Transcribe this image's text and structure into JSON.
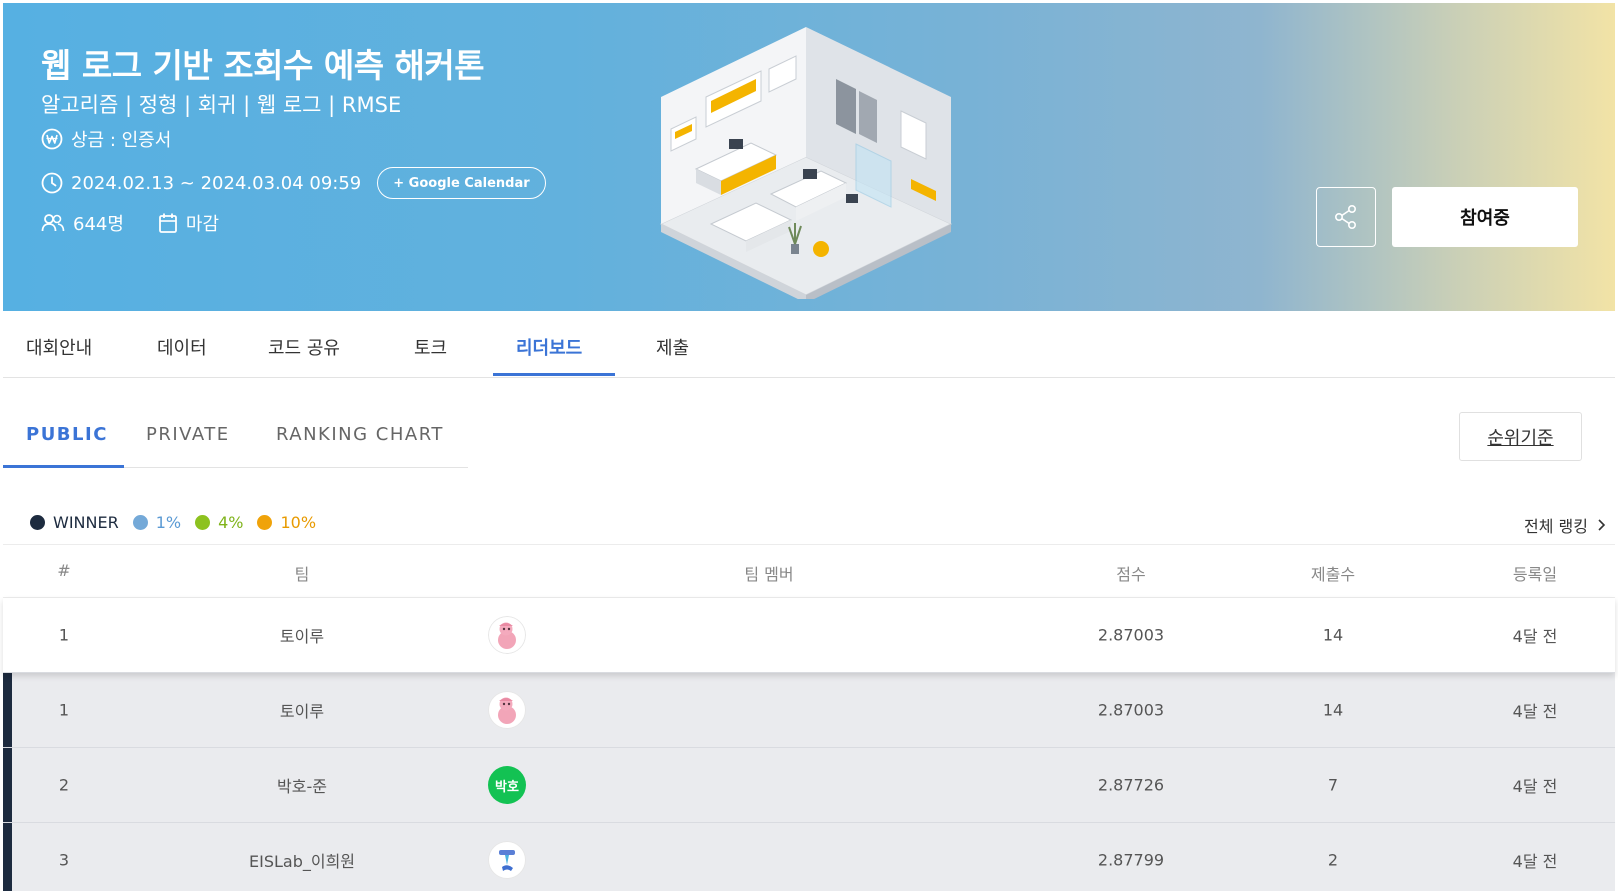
{
  "banner": {
    "title": "웹 로그 기반 조회수 예측 해커톤",
    "tags": "알고리즘 | 정형 | 회귀 | 웹 로그 | RMSE",
    "prize": "상금 : 인증서",
    "date_range": "2024.02.13 ~ 2024.03.04 09:59",
    "gcal_label": "+ Google Calendar",
    "participants": "644명",
    "status": "마감",
    "join_label": "참여중",
    "icons": [
      "won-icon",
      "clock-icon",
      "people-icon",
      "calendar-icon",
      "share-icon"
    ]
  },
  "main_tabs": [
    {
      "label": "대회안내"
    },
    {
      "label": "데이터"
    },
    {
      "label": "코드 공유"
    },
    {
      "label": "토크"
    },
    {
      "label": "리더보드",
      "active": true
    },
    {
      "label": "제출"
    }
  ],
  "sub_tabs": [
    {
      "label": "PUBLIC",
      "active": true
    },
    {
      "label": "PRIVATE"
    },
    {
      "label": "RANKING CHART"
    }
  ],
  "rank_basis_label": "순위기준",
  "legend": [
    {
      "label": "WINNER",
      "color": "#1d2b3f"
    },
    {
      "label": "1%",
      "color": "#74a9d8"
    },
    {
      "label": "4%",
      "color": "#8dc21f"
    },
    {
      "label": "10%",
      "color": "#f0a30a"
    }
  ],
  "full_ranking_label": "전체 랭킹",
  "table": {
    "headers": {
      "rank": "#",
      "team": "팀",
      "members": "팀 멤버",
      "score": "점수",
      "subs": "제출수",
      "date": "등록일"
    },
    "rows": [
      {
        "rank": "1",
        "team": "토이루",
        "avatar": "pink-character-avatar",
        "score": "2.87003",
        "subs": "14",
        "date": "4달 전",
        "own": true
      },
      {
        "rank": "1",
        "team": "토이루",
        "avatar": "pink-character-avatar",
        "score": "2.87003",
        "subs": "14",
        "date": "4달 전"
      },
      {
        "rank": "2",
        "team": "박호-준",
        "avatar_text": "박호",
        "score": "2.87726",
        "subs": "7",
        "date": "4달 전"
      },
      {
        "rank": "3",
        "team": "EISLab_이희원",
        "avatar": "blue-figure-avatar",
        "score": "2.87799",
        "subs": "2",
        "date": "4달 전"
      }
    ]
  }
}
